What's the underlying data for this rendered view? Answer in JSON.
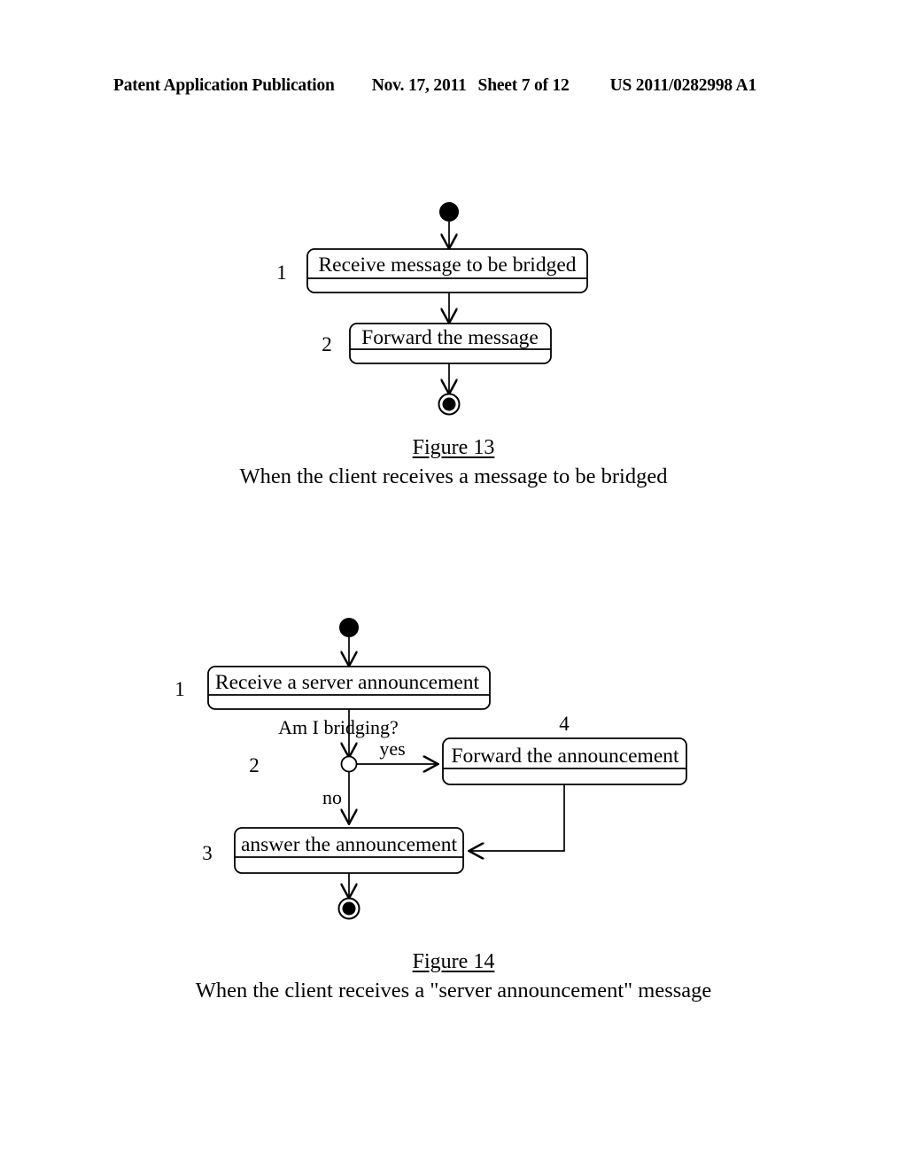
{
  "header": {
    "publication": "Patent Application Publication",
    "date": "Nov. 17, 2011",
    "sheet": "Sheet 7 of 12",
    "patent_number": "US 2011/0282998 A1"
  },
  "colors": {
    "ink": "#000000",
    "paper": "#ffffff"
  },
  "figures": [
    {
      "id": "figure-13",
      "caption_title": "Figure 13",
      "caption_subtitle": "When the client receives a message to be bridged",
      "start_node": "filled-circle",
      "end_node": "bullseye-circle",
      "steps": [
        {
          "number": "1",
          "label": "Receive message to be bridged"
        },
        {
          "number": "2",
          "label": "Forward the message"
        }
      ]
    },
    {
      "id": "figure-14",
      "caption_title": "Figure 14",
      "caption_subtitle": "When the client receives a \"server announcement\" message",
      "start_node": "filled-circle",
      "end_node": "bullseye-circle",
      "decision_question": "Am I bridging?",
      "branch_yes": "yes",
      "branch_no": "no",
      "steps": [
        {
          "number": "1",
          "label": "Receive a server announcement"
        },
        {
          "number": "2",
          "label": ""
        },
        {
          "number": "3",
          "label": "answer the announcement"
        },
        {
          "number": "4",
          "label": "Forward the announcement"
        }
      ]
    }
  ]
}
